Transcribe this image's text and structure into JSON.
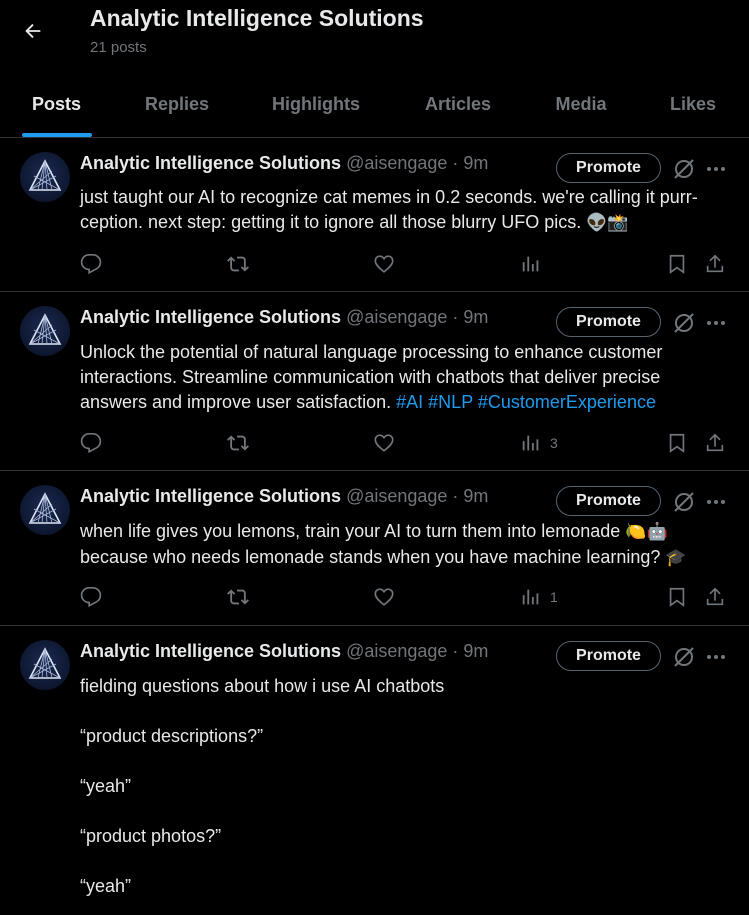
{
  "header": {
    "title": "Analytic Intelligence Solutions",
    "post_count": "21 posts"
  },
  "tabs": [
    {
      "label": "Posts",
      "active": true
    },
    {
      "label": "Replies"
    },
    {
      "label": "Highlights"
    },
    {
      "label": "Articles"
    },
    {
      "label": "Media"
    },
    {
      "label": "Likes"
    }
  ],
  "colors": {
    "accent": "#1d9bf0",
    "muted": "#71767b",
    "divider": "#2f3336"
  },
  "posts": [
    {
      "name": "Analytic Intelligence Solutions",
      "meta": "@aisengage · 9m",
      "promote": "Promote",
      "text_a": "just taught our AI to recognize cat memes in 0.2 seconds. we're calling it purr-ception. next step: getting it to ignore all those blurry UFO pics. ",
      "emoji_a": "👽📸",
      "views": ""
    },
    {
      "name": "Analytic Intelligence Solutions",
      "meta": "@aisengage · 9m",
      "promote": "Promote",
      "text_a": "Unlock the potential of natural language processing to enhance customer interactions. Streamline communication with chatbots that deliver precise answers and improve user satisfaction. ",
      "hashtags": "#AI #NLP #CustomerExperience",
      "views": "3"
    },
    {
      "name": "Analytic Intelligence Solutions",
      "meta": "@aisengage · 9m",
      "promote": "Promote",
      "text_a": "when life gives you lemons, train your AI to turn them into lemonade ",
      "emoji_a": "🍋🤖",
      "text_b": " because who needs lemonade stands when you have machine learning? ",
      "emoji_b": "🎓",
      "views": "1"
    },
    {
      "name": "Analytic Intelligence Solutions",
      "meta": "@aisengage · 9m",
      "promote": "Promote",
      "lines": [
        "fielding questions about how i use AI chatbots",
        "“product descriptions?”",
        "“yeah”",
        "“product photos?”",
        "“yeah”"
      ]
    }
  ]
}
